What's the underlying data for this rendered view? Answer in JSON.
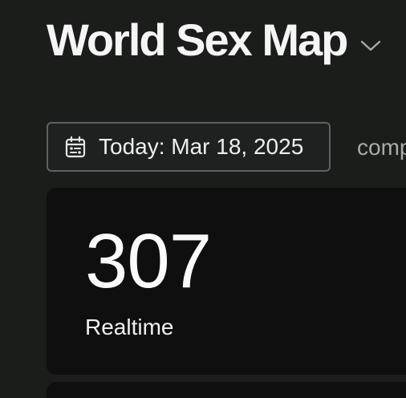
{
  "header": {
    "title": "World Sex Map",
    "chevron_icon": "chevron-down-icon"
  },
  "date_picker": {
    "icon": "calendar-icon",
    "label": "Today: Mar 18, 2025"
  },
  "compare": {
    "label": "comp"
  },
  "stats": {
    "realtime_value": "307",
    "realtime_label": "Realtime"
  }
}
